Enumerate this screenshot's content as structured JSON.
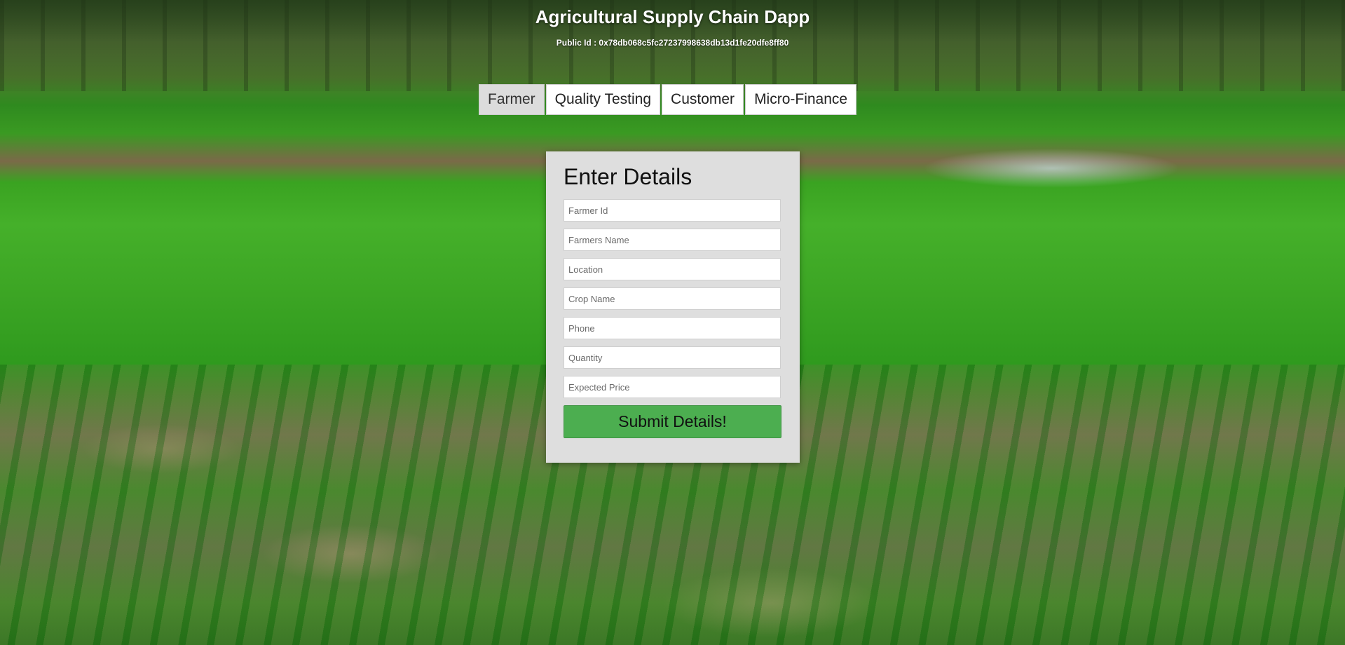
{
  "app": {
    "title": "Agricultural Supply Chain Dapp",
    "public_id": "Public Id : 0x78db068c5fc27237998638db13d1fe20dfe8ff80"
  },
  "tabs": [
    {
      "label": "Farmer",
      "active": true
    },
    {
      "label": "Quality Testing",
      "active": false
    },
    {
      "label": "Customer",
      "active": false
    },
    {
      "label": "Micro-Finance",
      "active": false
    }
  ],
  "form": {
    "title": "Enter Details",
    "fields": [
      {
        "placeholder": "Farmer Id",
        "value": ""
      },
      {
        "placeholder": "Farmers Name",
        "value": ""
      },
      {
        "placeholder": "Location",
        "value": ""
      },
      {
        "placeholder": "Crop Name",
        "value": ""
      },
      {
        "placeholder": "Phone",
        "value": ""
      },
      {
        "placeholder": "Quantity",
        "value": ""
      },
      {
        "placeholder": "Expected Price",
        "value": ""
      }
    ],
    "submit_label": "Submit Details!"
  },
  "colors": {
    "submit_button": "#4cae50",
    "card_background": "#dedede",
    "active_tab": "#dcdcdc"
  }
}
